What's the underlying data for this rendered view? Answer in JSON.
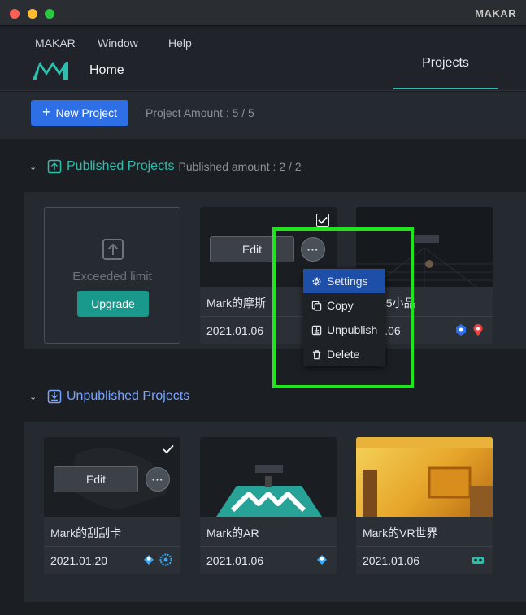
{
  "window": {
    "title": "MAKAR"
  },
  "menubar": {
    "items": [
      "MAKAR",
      "Window",
      "Help"
    ]
  },
  "header": {
    "home_label": "Home",
    "active_tab": "Projects"
  },
  "toolbar": {
    "new_project_label": "New Project",
    "project_amount": "Project Amount : 5 / 5"
  },
  "published": {
    "title": "Published Projects",
    "amount": "Published amount : 2 / 2",
    "exceeded_text": "Exceeded limit",
    "upgrade_label": "Upgrade",
    "cards": [
      {
        "name": "Mark的摩斯",
        "date": "2021.01.06",
        "edit_label": "Edit",
        "more_label": "···",
        "icons": [
          "ar-cube-icon"
        ]
      },
      {
        "name": "k的35小品",
        "date": "1.01.06",
        "icons": [
          "ar-cube-icon",
          "location-pin-icon"
        ]
      }
    ]
  },
  "context_menu": {
    "items": [
      {
        "label": "Settings",
        "icon": "gear-icon",
        "active": true
      },
      {
        "label": "Copy",
        "icon": "copy-icon",
        "active": false
      },
      {
        "label": "Unpublish",
        "icon": "unpublish-icon",
        "active": false
      },
      {
        "label": "Delete",
        "icon": "trash-icon",
        "active": false
      }
    ]
  },
  "unpublished": {
    "title": "Unpublished Projects",
    "cards": [
      {
        "name": "Mark的刮刮卡",
        "date": "2021.01.20",
        "edit_label": "Edit",
        "more_label": "···",
        "icons": [
          "scan-icon",
          "ar-cube-icon"
        ]
      },
      {
        "name": "Mark的AR",
        "date": "2021.01.06",
        "icons": [
          "scan-icon"
        ]
      },
      {
        "name": "Mark的VR世界",
        "date": "2021.01.06",
        "icons": [
          "vr-headset-icon"
        ]
      }
    ]
  },
  "colors": {
    "accent_teal": "#2bbfae",
    "primary_blue": "#2e6fe6",
    "highlight_green": "#21e51c",
    "menu_active": "#1d4fa8"
  }
}
